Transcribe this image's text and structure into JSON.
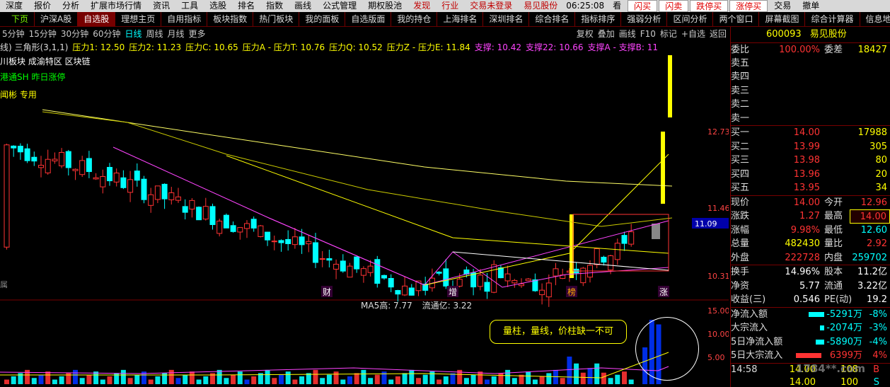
{
  "menubar": {
    "items": [
      "深度",
      "报价",
      "分析",
      "扩展市场行情",
      "资讯",
      "工具",
      "选股",
      "排名",
      "指数",
      "画线",
      "公式管理",
      "期权股池",
      "发现",
      "行业",
      "交易未登录",
      "易见股份",
      "06:25:08",
      "看",
      "闪买",
      "闪卖",
      "跌停买",
      "涨停买",
      "交易",
      "撤单"
    ]
  },
  "tabbar": {
    "items": [
      "下页",
      "沪深A股",
      "自选股",
      "理想主页",
      "自用指标",
      "板块指数",
      "热门板块",
      "我的面板",
      "自选版面",
      "我的持仓",
      "上海排名",
      "深圳排名",
      "综合排名",
      "指标排序",
      "强弱分析",
      "区间分析",
      "两个窗口",
      "屏幕截图",
      "综合计算器",
      "信息地雷"
    ],
    "active": "自选股"
  },
  "periodbar": {
    "left": [
      "5分钟",
      "15分钟",
      "30分钟",
      "60分钟",
      "日线",
      "周线",
      "月线",
      "更多"
    ],
    "active": "日线",
    "right": [
      "复权",
      "叠加",
      "画线",
      "F10",
      "标记",
      "+自选",
      "返回"
    ]
  },
  "indicator": {
    "name": "线) 三角形(3,1,1)",
    "items": [
      {
        "t": "压力1: 12.50",
        "c": "#ffff00"
      },
      {
        "t": "压力2: 11.23",
        "c": "#ffff00"
      },
      {
        "t": "压力C: 10.65",
        "c": "#ffff00"
      },
      {
        "t": "压力A - 压力T: 10.76",
        "c": "#ffff00"
      },
      {
        "t": "压力Q: 10.52",
        "c": "#ffff00"
      },
      {
        "t": "压力Z - 压力E: 11.84",
        "c": "#ffff00"
      },
      {
        "t": "支撑: 10.42",
        "c": "#ff44ff"
      },
      {
        "t": "支撑22: 10.66",
        "c": "#ff44ff"
      },
      {
        "t": "支撑A - 支撑B: 11",
        "c": "#ff44ff"
      }
    ]
  },
  "chart_labels": {
    "blocks": "川板块 成渝特区 区块链",
    "hgt": "港通SH 昨日涨停",
    "fund": "闻彬 专用",
    "left_mark": "属"
  },
  "price_axis": {
    "labels": [
      "12.73",
      "11.46",
      "11.09",
      "10.31"
    ]
  },
  "markers": [
    "财",
    "增",
    "榜",
    "涨"
  ],
  "vol_axis": {
    "labels": [
      "15.00",
      "10.00",
      "5.00"
    ]
  },
  "vol_header": {
    "items": [
      "流通亿: 3.22"
    ],
    "ma_label": "MA5高: 7.77"
  },
  "annotation": "量柱，量线，价柱缺一不可",
  "quote": {
    "code": "600093",
    "name": "易见股份",
    "weibi": {
      "label": "委比",
      "value": "100.00%",
      "label2": "委差",
      "value2": "18427"
    },
    "sell": [
      {
        "l": "卖五",
        "p": "",
        "v": ""
      },
      {
        "l": "卖四",
        "p": "",
        "v": ""
      },
      {
        "l": "卖三",
        "p": "",
        "v": ""
      },
      {
        "l": "卖二",
        "p": "",
        "v": ""
      },
      {
        "l": "卖一",
        "p": "",
        "v": ""
      }
    ],
    "buy": [
      {
        "l": "买一",
        "p": "14.00",
        "v": "17988"
      },
      {
        "l": "买二",
        "p": "13.99",
        "v": "305"
      },
      {
        "l": "买三",
        "p": "13.98",
        "v": "80"
      },
      {
        "l": "买四",
        "p": "13.96",
        "v": "20"
      },
      {
        "l": "买五",
        "p": "13.95",
        "v": "34"
      }
    ],
    "stats": [
      {
        "l": "现价",
        "v": "14.00",
        "vc": "red",
        "l2": "今开",
        "v2": "12.96",
        "v2c": "red"
      },
      {
        "l": "涨跌",
        "v": "1.27",
        "vc": "red",
        "l2": "最高",
        "v2": "14.00",
        "v2c": "red",
        "hl": true
      },
      {
        "l": "涨幅",
        "v": "9.98%",
        "vc": "red",
        "l2": "最低",
        "v2": "12.60",
        "v2c": "cyn"
      },
      {
        "l": "总量",
        "v": "482430",
        "vc": "yel",
        "l2": "量比",
        "v2": "2.92",
        "v2c": "red"
      },
      {
        "l": "外盘",
        "v": "222728",
        "vc": "red",
        "l2": "内盘",
        "v2": "259702",
        "v2c": "cyn"
      }
    ],
    "stats2": [
      {
        "l": "换手",
        "v": "14.96%",
        "vc": "wht",
        "l2": "股本",
        "v2": "11.2亿",
        "v2c": "wht"
      },
      {
        "l": "净资",
        "v": "5.77",
        "vc": "wht",
        "l2": "流通",
        "v2": "3.22亿",
        "v2c": "wht"
      },
      {
        "l": "收益(三)",
        "v": "0.546",
        "vc": "wht",
        "l2": "PE(动)",
        "v2": "19.2",
        "v2c": "wht"
      }
    ],
    "flows": [
      {
        "l": "净流入额",
        "v": "-5291万",
        "p": "-8%",
        "c": "#00ffff",
        "w": 22
      },
      {
        "l": "大宗流入",
        "v": "-2074万",
        "p": "-3%",
        "c": "#00ffff",
        "w": 6
      },
      {
        "l": "5日净流入额",
        "v": "-5890万",
        "p": "-4%",
        "c": "#00ffff",
        "w": 12
      },
      {
        "l": "5日大宗流入",
        "v": "6399万",
        "p": "4%",
        "c": "#ff3333",
        "w": 36
      }
    ],
    "ticks": [
      {
        "t": "14:58",
        "p": "14.00",
        "v": "108",
        "s": "B"
      },
      {
        "t": "",
        "p": "14.00",
        "v": "100",
        "s": "S"
      }
    ]
  },
  "watermark": "1784**.com"
}
